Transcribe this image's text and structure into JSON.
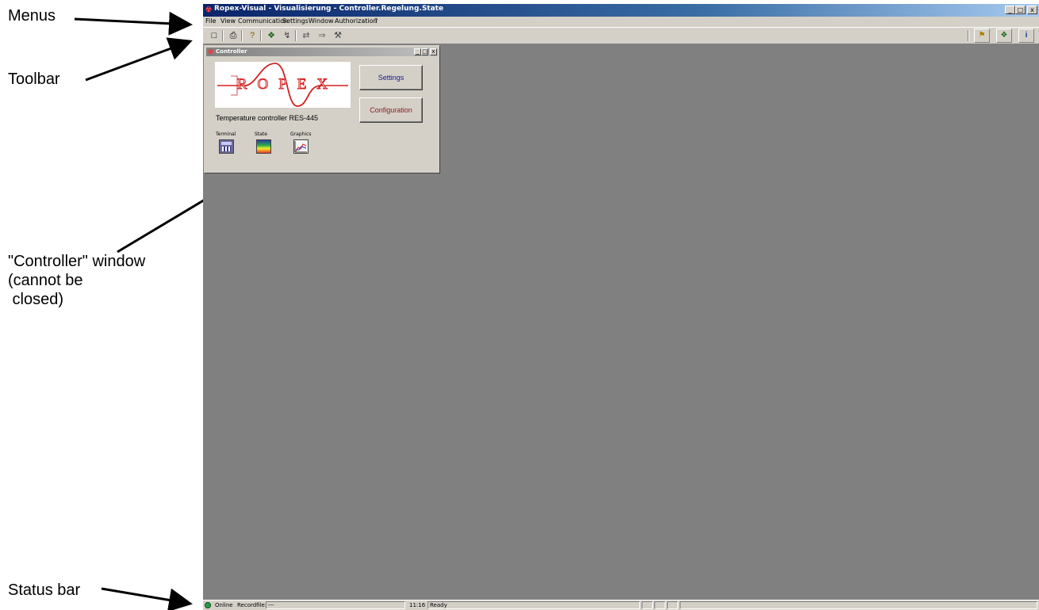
{
  "annotations": {
    "menus": "Menus",
    "toolbar": "Toolbar",
    "controller_window": "\"Controller\" window\n(cannot be\n closed)",
    "status_bar": "Status bar"
  },
  "app": {
    "title": "Ropex-Visual - Visualisierung - Controller.Regelung.State",
    "caption_buttons": {
      "minimize": "_",
      "restore": "□",
      "close": "x"
    },
    "menu": [
      "File",
      "View",
      "Communication",
      "Settings",
      "Window",
      "Authorization",
      "?"
    ],
    "toolbar_left": [
      {
        "name": "new-icon",
        "glyph": "□"
      },
      {
        "name": "print-icon",
        "glyph": "⎙"
      },
      {
        "name": "help-icon",
        "glyph": "?"
      },
      {
        "name": "connect-icon",
        "glyph": "❖"
      },
      {
        "name": "signal-icon",
        "glyph": "↯"
      },
      {
        "name": "transfer-icon",
        "glyph": "⇄"
      },
      {
        "name": "arrow-icon",
        "glyph": "⇒"
      },
      {
        "name": "tools-icon",
        "glyph": "⚒"
      }
    ],
    "toolbar_right": [
      {
        "name": "network-icon",
        "glyph": "⚑"
      },
      {
        "name": "device-icon",
        "glyph": "❖"
      },
      {
        "name": "info-icon",
        "glyph": "i"
      }
    ]
  },
  "controller": {
    "title": "Controller",
    "logo_text": "ROPEX",
    "settings_button": "Settings",
    "configuration_button": "Configuration",
    "model": "Temperature controller RES-445",
    "tools": [
      {
        "label": "Terminal",
        "icon": "terminal-icon"
      },
      {
        "label": "State",
        "icon": "state-icon"
      },
      {
        "label": "Graphics",
        "icon": "graphics-icon"
      }
    ]
  },
  "statusbar": {
    "online": "Online",
    "recordfile_label": "Recordfile:",
    "recordfile_value": "---",
    "time": "11:16",
    "status": "Ready"
  },
  "colors": {
    "accent": "#0a246a",
    "workspace": "#808080",
    "logo_red": "#d42020"
  }
}
